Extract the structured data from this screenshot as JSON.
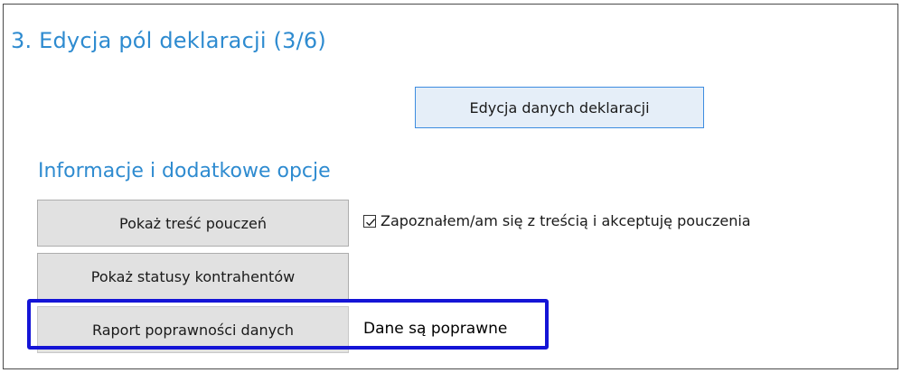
{
  "section": {
    "title": "3. Edycja pól deklaracji (3/6)"
  },
  "edit_button": {
    "label": "Edycja danych deklaracji"
  },
  "info_section": {
    "title": "Informacje i dodatkowe opcje",
    "show_instructions_label": "Pokaż treść pouczeń",
    "acknowledge_checkbox": {
      "checked": true,
      "label": "Zapoznałem/am się z treścią i akceptuję pouczenia"
    },
    "show_contractor_status_label": "Pokaż statusy kontrahentów",
    "data_report_label": "Raport poprawności danych",
    "data_status_text": "Dane są poprawne"
  },
  "colors": {
    "heading_blue": "#2e8bd0",
    "highlight_blue": "#1414d6",
    "button_gray": "#e1e1e1"
  }
}
